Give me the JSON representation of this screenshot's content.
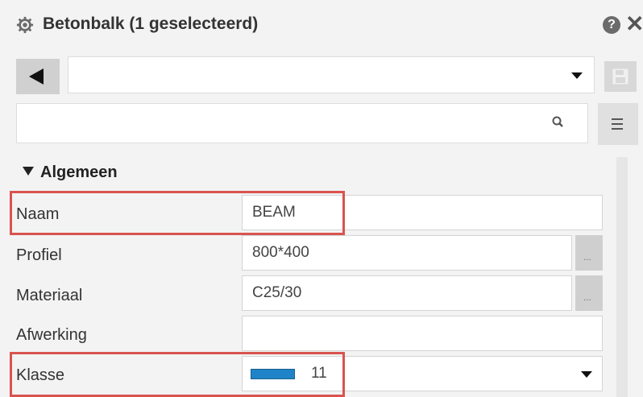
{
  "panel": {
    "title": "Betonbalk (1 geselecteerd)",
    "help_label": "?",
    "close_label": "✕"
  },
  "toolbar": {
    "combo_value": "",
    "search_value": "",
    "search_placeholder": ""
  },
  "group": {
    "title": "Algemeen"
  },
  "properties": [
    {
      "label": "Naam",
      "value": "BEAM",
      "highlighted": true
    },
    {
      "label": "Profiel",
      "value": "800*400",
      "has_ellipsis": true
    },
    {
      "label": "Materiaal",
      "value": "C25/30",
      "has_ellipsis": true
    },
    {
      "label": "Afwerking",
      "value": ""
    },
    {
      "label": "Klasse",
      "value": "11",
      "swatch_color": "#1e84c7",
      "has_dropdown": true,
      "highlighted": true
    }
  ],
  "ellipsis_label": "...",
  "colors": {
    "highlight": "#d9534f",
    "background": "#f3f3f3"
  }
}
